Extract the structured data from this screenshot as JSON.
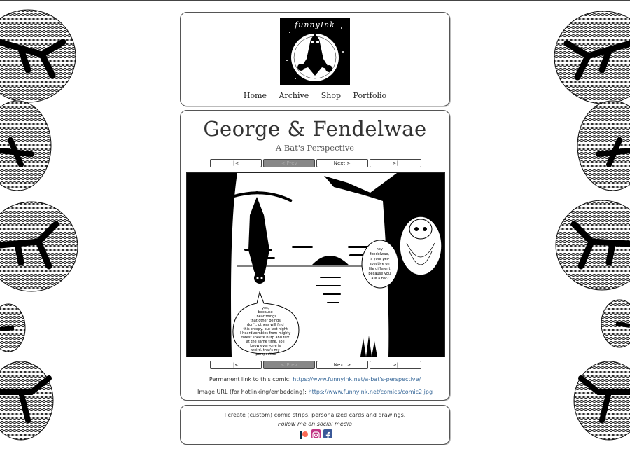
{
  "logo": {
    "text": "funnyInk",
    "alt": "funnyInk bat logo"
  },
  "nav": {
    "items": [
      "Home",
      "Archive",
      "Shop",
      "Portfolio"
    ]
  },
  "comic": {
    "title": "George & Fendelwae",
    "subtitle": "A Bat's Perspective",
    "nav": {
      "first": "|<",
      "prev": "< Prev",
      "next": "Next >",
      "last": ">|"
    },
    "bubble_owl": [
      "hey",
      "fendelwae,",
      "is your per-",
      "spective on",
      "life different",
      "because you",
      "are a bat?"
    ],
    "bubble_bat": [
      "yes,",
      "because",
      "I hear things",
      "that other beings",
      "don't. others will find",
      "this creepy. but last night",
      "I heard zombies from mighty",
      "forest sneeze burp and fart",
      "at the same time, so I",
      "know everyone is",
      "weird. that's my",
      "perspective"
    ]
  },
  "links": {
    "permalink_label": "Permanent link to this comic:",
    "permalink_url": "https://www.funnyink.net/a-bat's-perspective/",
    "image_label": "Image URL (for hotlinking/embedding):",
    "image_url": "https://www.funnyink.net/comics/comic2.jpg"
  },
  "footer": {
    "line1": "I create (custom) comic strips, personalized cards and drawings.",
    "line2": "Follow me on social media",
    "socials": [
      {
        "name": "patreon-icon",
        "color": "#f96854"
      },
      {
        "name": "instagram-icon",
        "color": "#c13584"
      },
      {
        "name": "facebook-icon",
        "color": "#3b5998"
      }
    ]
  }
}
